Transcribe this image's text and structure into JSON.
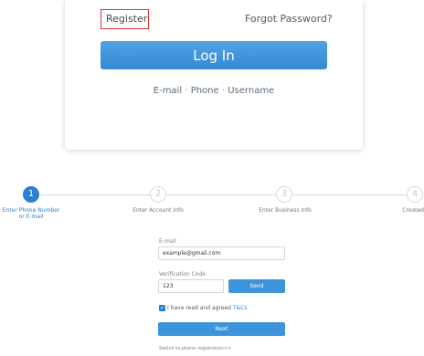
{
  "login": {
    "register_label": "Register",
    "forgot_label": "Forgot Password?",
    "login_button": "Log In",
    "methods": [
      "E-mail",
      "Phone",
      "Username"
    ],
    "method_separator": "·"
  },
  "stepper": {
    "steps": [
      {
        "number": "1",
        "label": "Enter Phone Number or E-mail",
        "state": "active"
      },
      {
        "number": "2",
        "label": "Enter Account Info",
        "state": "inactive"
      },
      {
        "number": "3",
        "label": "Enter Business Info",
        "state": "inactive"
      },
      {
        "number": "4",
        "label": "Created",
        "state": "inactive"
      }
    ]
  },
  "form": {
    "email_label": "E-mail",
    "email_value": "example@gmail.com",
    "code_label": "Verification Code",
    "code_value": "123",
    "send_button": "Send",
    "agree_text": "I have read and agreed",
    "tc_link": "T&Cs",
    "next_button": "Next",
    "switch_link": "Switch to phone registration>>"
  },
  "colors": {
    "accent": "#2d7fd3",
    "button": "#3e94dc",
    "register_border": "#d9342b"
  }
}
